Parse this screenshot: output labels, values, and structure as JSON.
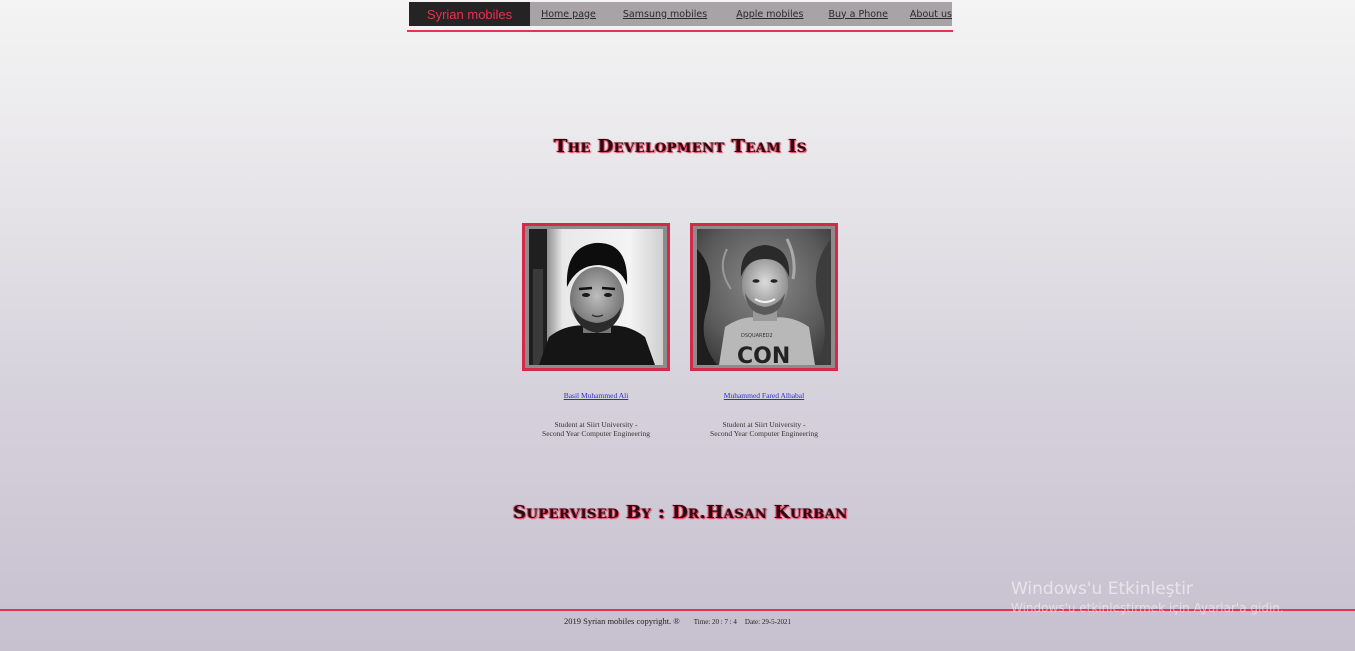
{
  "nav": {
    "brand": "Syrian mobiles",
    "links": [
      "Home page",
      "Samsung mobiles",
      "Apple mobiles",
      "Buy a Phone",
      "About us"
    ]
  },
  "team_heading": "The Development Team Is",
  "members": [
    {
      "name": "Basil Muhammed Ali",
      "desc_line1": "Student at Siirt University -",
      "desc_line2": "Second Year Computer Engineering"
    },
    {
      "name": "Muhammed Fared Alhabal",
      "desc_line1": "Student at Siirt University -",
      "desc_line2": "Second Year Computer Engineering"
    }
  ],
  "supervisor_heading": "Supervised By : Dr.Hasan Kurban",
  "footer": {
    "copyright": "2019 Syrian mobiles copyright. ®",
    "time": "Time: 20 : 7 : 4",
    "date": "Date: 29-5-2021"
  },
  "watermark": {
    "title": "Windows'u Etkinleştir",
    "subtitle": "Windows'u etkinleştirmek için Ayarlar'a gidin."
  },
  "colors": {
    "accent": "#e8324f",
    "brand_bg": "#262325",
    "nav_bg": "#a7a3a7",
    "link": "#2c2ccf"
  }
}
